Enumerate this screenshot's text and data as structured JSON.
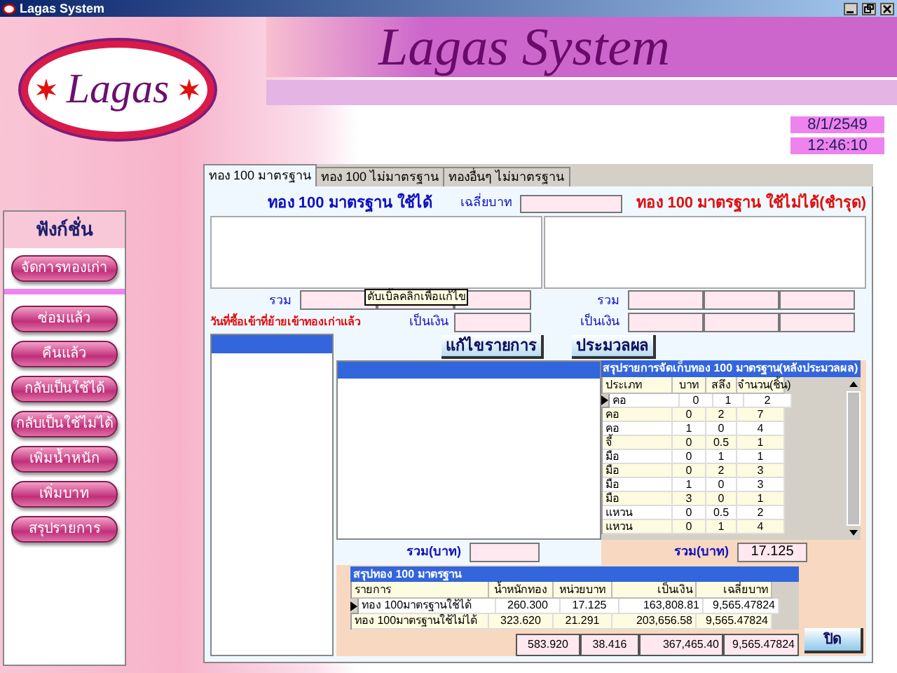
{
  "window": {
    "title": "Lagas System"
  },
  "header": {
    "logo_text": "Lagas",
    "title": "Lagas System",
    "date": "8/1/2549",
    "time": "12:46:10"
  },
  "sidebar": {
    "title": "ฟังก์ชั่น",
    "main_button": "จัดการทองเก่า",
    "items": [
      "ซ่อมแล้ว",
      "คืนแล้ว",
      "กลับเป็นใช้ได้",
      "กลับเป็นใช้ไม่ได้",
      "เพิ่มน้ำหนัก",
      "เพิ่มบาท",
      "สรุปรายการ"
    ]
  },
  "tabs": [
    {
      "label": "ทอง 100 มาตรฐาน",
      "selected": true
    },
    {
      "label": "ทอง 100 ไม่มาตรฐาน",
      "selected": false
    },
    {
      "label": "ทองอื่นๆ ไม่มาตรฐาน",
      "selected": false
    }
  ],
  "form": {
    "usable_title": "ทอง 100 มาตรฐาน ใช้ได้",
    "avg_label": "เฉลี่ยบาท",
    "unusable_title": "ทอง 100 มาตรฐาน ใช้ไม่ได้(ชำรุด)",
    "total_label_left": "รวม",
    "tooltip": "ดับเบิ้ลคลิกเพื่อแก้ไข",
    "bought_label": "วันที่ซื้อเข้าที่ย้ายเข้าทองเก่าแล้ว",
    "money_label_left": "เป็นเงิน",
    "total_label_right": "รวม",
    "money_label_right": "เป็นเงิน",
    "edit_button": "แก้ไขรายการ",
    "process_button": "ประมวลผล"
  },
  "grid": {
    "title": "สรุปรายการจัดเก็บทอง 100 มาตรฐาน(หลังประมวลผล)",
    "columns": [
      "ประเภท",
      "บาท",
      "สลึง",
      "จำนวน(ชิ้น)"
    ],
    "rows": [
      {
        "selected": true,
        "cells": [
          "คอ",
          "0",
          "1",
          "2"
        ]
      },
      {
        "selected": false,
        "cells": [
          "คอ",
          "0",
          "2",
          "7"
        ]
      },
      {
        "selected": false,
        "cells": [
          "คอ",
          "1",
          "0",
          "4"
        ]
      },
      {
        "selected": false,
        "cells": [
          "จี้",
          "0",
          "0.5",
          "1"
        ]
      },
      {
        "selected": false,
        "cells": [
          "มือ",
          "0",
          "1",
          "1"
        ]
      },
      {
        "selected": false,
        "cells": [
          "มือ",
          "0",
          "2",
          "3"
        ]
      },
      {
        "selected": false,
        "cells": [
          "มือ",
          "1",
          "0",
          "3"
        ]
      },
      {
        "selected": false,
        "cells": [
          "มือ",
          "3",
          "0",
          "1"
        ]
      },
      {
        "selected": false,
        "cells": [
          "แหวน",
          "0",
          "0.5",
          "2"
        ]
      },
      {
        "selected": false,
        "cells": [
          "แหวน",
          "0",
          "1",
          "4"
        ]
      }
    ]
  },
  "totals": {
    "left_label": "รวม(บาท)",
    "right_label": "รวม(บาท)",
    "right_value": "17.125"
  },
  "summary": {
    "title": "สรุปทอง 100 มาตรฐาน",
    "columns": [
      "รายการ",
      "น้ำหนักทอง",
      "หน่วยบาท",
      "เป็นเงิน",
      "เฉลี่ยบาท"
    ],
    "rows": [
      {
        "selected": true,
        "cells": [
          "ทอง 100มาตรฐานใช้ได้",
          "260.300",
          "17.125",
          "163,808.81",
          "9,565.47824"
        ]
      },
      {
        "selected": false,
        "cells": [
          "ทอง 100มาตรฐานใช้ไม่ได้",
          "323.620",
          "21.291",
          "203,656.58",
          "9,565.47824"
        ]
      }
    ],
    "totals": [
      "583.920",
      "38.416",
      "367,465.40",
      "9,565.47824"
    ],
    "close_button": "ปิด"
  }
}
